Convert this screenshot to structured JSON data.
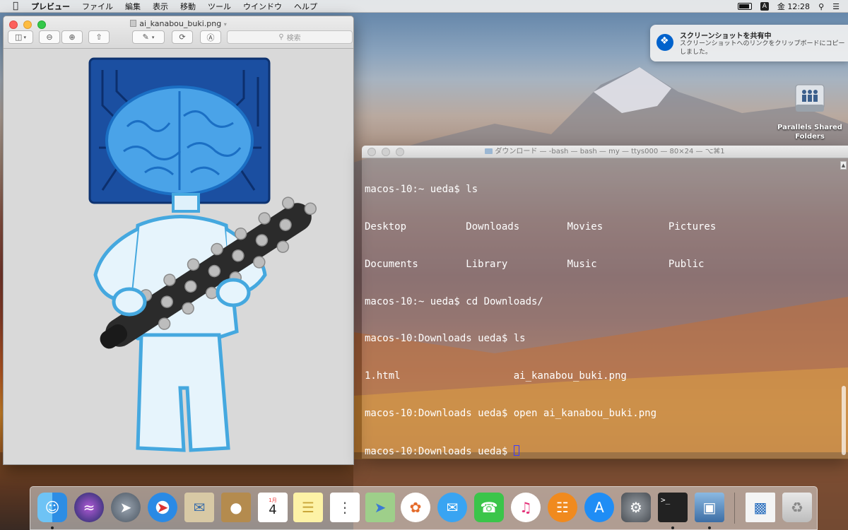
{
  "menubar": {
    "app_name": "プレビュー",
    "menus": [
      "ファイル",
      "編集",
      "表示",
      "移動",
      "ツール",
      "ウインドウ",
      "ヘルプ"
    ],
    "ime_indicator": "A",
    "clock": "金 12:28"
  },
  "preview_window": {
    "title": "ai_kanabou_buki.png",
    "search_placeholder": "検索"
  },
  "terminal_window": {
    "title": "ダウンロード — -bash — bash — my — ttys000 — 80×24 — ⌥⌘1",
    "lines": [
      "macos-10:~ ueda$ ls",
      "Desktop          Downloads        Movies           Pictures",
      "Documents        Library          Music            Public",
      "macos-10:~ ueda$ cd Downloads/",
      "macos-10:Downloads ueda$ ls",
      "1.html                   ai_kanabou_buki.png",
      "macos-10:Downloads ueda$ open ai_kanabou_buki.png",
      "macos-10:Downloads ueda$ "
    ]
  },
  "notification": {
    "title": "スクリーンショットを共有中",
    "message": "スクリーンショットへのリンクをクリップボードにコピーしました。"
  },
  "desktop": {
    "icons": [
      {
        "label": "Parallels Shared Folders"
      }
    ]
  },
  "dock": {
    "calendar_month": "1月",
    "calendar_day": "4",
    "items": [
      {
        "name": "Finder",
        "running": true
      },
      {
        "name": "Siri",
        "running": false
      },
      {
        "name": "Launchpad",
        "running": false
      },
      {
        "name": "Safari",
        "running": false
      },
      {
        "name": "Mail",
        "running": false
      },
      {
        "name": "Contacts",
        "running": false
      },
      {
        "name": "Calendar",
        "running": false
      },
      {
        "name": "Notes",
        "running": false
      },
      {
        "name": "Reminders",
        "running": false
      },
      {
        "name": "Maps",
        "running": false
      },
      {
        "name": "Photos",
        "running": false
      },
      {
        "name": "Messages",
        "running": false
      },
      {
        "name": "FaceTime",
        "running": false
      },
      {
        "name": "iTunes",
        "running": false
      },
      {
        "name": "iBooks",
        "running": false
      },
      {
        "name": "App Store",
        "running": false
      },
      {
        "name": "System Preferences",
        "running": false
      },
      {
        "name": "Terminal",
        "running": true
      },
      {
        "name": "Preview",
        "running": true
      },
      {
        "name": "Downloads",
        "running": false
      },
      {
        "name": "Trash",
        "running": false
      }
    ]
  }
}
